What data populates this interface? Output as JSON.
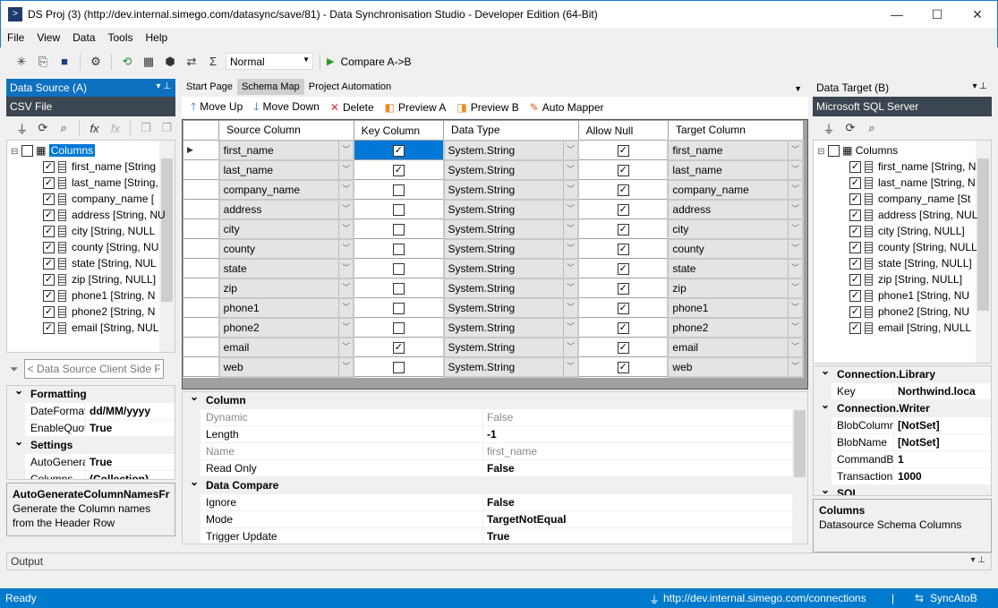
{
  "window": {
    "title": "DS Proj (3) (http://dev.internal.simego.com/datasync/save/81) - Data Synchronisation Studio - Developer Edition (64-Bit)",
    "minimize": "—",
    "maximize": "☐",
    "close": "✕"
  },
  "menu": [
    "File",
    "View",
    "Data",
    "Tools",
    "Help"
  ],
  "toolbar": {
    "mode": "Normal",
    "compare": "Compare A->B",
    "icons": [
      "new-project-icon",
      "open-icon",
      "save-icon",
      "settings-icon",
      "connect-icon",
      "schema-icon",
      "library-icon",
      "sync-icon",
      "function-icon"
    ]
  },
  "left": {
    "title": "Data Source (A)",
    "type": "CSV File",
    "root": "Columns",
    "columns": [
      "first_name [String",
      "last_name [String,",
      "company_name [",
      "address [String, NU",
      "city [String, NULL",
      "county [String, NU",
      "state [String, NUL",
      "zip [String, NULL]",
      "phone1 [String, N",
      "phone2 [String, N",
      "email [String, NUL"
    ],
    "filter_placeholder": "< Data Source Client Side Filter >",
    "props": [
      {
        "cat": "Formatting"
      },
      {
        "k": "DateFormat",
        "v": "dd/MM/yyyy"
      },
      {
        "k": "EnableQuot",
        "v": "True"
      },
      {
        "cat": "Settings"
      },
      {
        "k": "AutoGenera",
        "v": "True"
      },
      {
        "k": "Columns",
        "v": "(Collection)"
      }
    ],
    "desc_title": "AutoGenerateColumnNamesFr",
    "desc_text": "Generate the Column names from the Header Row"
  },
  "tabs": [
    "Start Page",
    "Schema Map",
    "Project Automation"
  ],
  "schema_toolbar": [
    {
      "icon": "arrow-up-icon",
      "glyph": "🡑",
      "label": "Move Up",
      "color": "#1a73c8"
    },
    {
      "icon": "arrow-down-icon",
      "glyph": "🡓",
      "label": "Move Down",
      "color": "#1a73c8"
    },
    {
      "icon": "delete-icon",
      "glyph": "✕",
      "label": "Delete",
      "color": "#e03030"
    },
    {
      "icon": "preview-a-icon",
      "glyph": "◧",
      "label": "Preview A",
      "color": "#f08a20"
    },
    {
      "icon": "preview-b-icon",
      "glyph": "◨",
      "label": "Preview B",
      "color": "#f08a20"
    },
    {
      "icon": "auto-mapper-icon",
      "glyph": "✎",
      "label": "Auto Mapper",
      "color": "#e06020"
    }
  ],
  "grid": {
    "headers": [
      "Source Column",
      "Key Column",
      "Data Type",
      "Allow Null",
      "Target Column"
    ],
    "rows": [
      {
        "src": "first_name",
        "key": true,
        "type": "System.String",
        "null": true,
        "target": "first_name"
      },
      {
        "src": "last_name",
        "key": true,
        "type": "System.String",
        "null": true,
        "target": "last_name"
      },
      {
        "src": "company_name",
        "key": false,
        "type": "System.String",
        "null": true,
        "target": "company_name"
      },
      {
        "src": "address",
        "key": false,
        "type": "System.String",
        "null": true,
        "target": "address"
      },
      {
        "src": "city",
        "key": false,
        "type": "System.String",
        "null": true,
        "target": "city"
      },
      {
        "src": "county",
        "key": false,
        "type": "System.String",
        "null": true,
        "target": "county"
      },
      {
        "src": "state",
        "key": false,
        "type": "System.String",
        "null": true,
        "target": "state"
      },
      {
        "src": "zip",
        "key": false,
        "type": "System.String",
        "null": true,
        "target": "zip"
      },
      {
        "src": "phone1",
        "key": false,
        "type": "System.String",
        "null": true,
        "target": "phone1"
      },
      {
        "src": "phone2",
        "key": false,
        "type": "System.String",
        "null": true,
        "target": "phone2"
      },
      {
        "src": "email",
        "key": true,
        "type": "System.String",
        "null": true,
        "target": "email"
      },
      {
        "src": "web",
        "key": false,
        "type": "System.String",
        "null": true,
        "target": "web"
      }
    ]
  },
  "center_props": [
    {
      "cat": "Column"
    },
    {
      "k": "Dynamic",
      "v": "False",
      "dim": true
    },
    {
      "k": "Length",
      "v": "-1"
    },
    {
      "k": "Name",
      "v": "first_name",
      "dim": true
    },
    {
      "k": "Read Only",
      "v": "False"
    },
    {
      "cat": "Data Compare"
    },
    {
      "k": "Ignore",
      "v": "False"
    },
    {
      "k": "Mode",
      "v": "TargetNotEqual"
    },
    {
      "k": "Trigger Update",
      "v": "True"
    }
  ],
  "right": {
    "title": "Data Target (B)",
    "type": "Microsoft SQL Server",
    "root": "Columns",
    "columns": [
      "first_name [String, N",
      "last_name [String, N",
      "company_name [St",
      "address [String, NUL",
      "city [String, NULL]",
      "county [String, NULL",
      "state [String, NULL]",
      "zip [String, NULL]",
      "phone1 [String, NU",
      "phone2 [String, NU",
      "email [String, NULL"
    ],
    "props": [
      {
        "cat": "Connection.Library"
      },
      {
        "k": "Key",
        "v": "Northwind.loca"
      },
      {
        "cat": "Connection.Writer"
      },
      {
        "k": "BlobColumn",
        "v": "[NotSet]"
      },
      {
        "k": "BlobName",
        "v": "[NotSet]"
      },
      {
        "k": "CommandB",
        "v": "1"
      },
      {
        "k": "Transaction",
        "v": "1000"
      },
      {
        "cat": "SQL"
      }
    ],
    "desc_title": "Columns",
    "desc_text": "Datasource Schema Columns"
  },
  "output": {
    "title": "Output"
  },
  "status": {
    "left": "Ready",
    "url": "http://dev.internal.simego.com/connections",
    "divider": "|",
    "sync": "SyncAtoB"
  },
  "colors": {
    "accent": "#007acc",
    "panel_header": "#0e70c0",
    "selection": "#0078d7"
  }
}
